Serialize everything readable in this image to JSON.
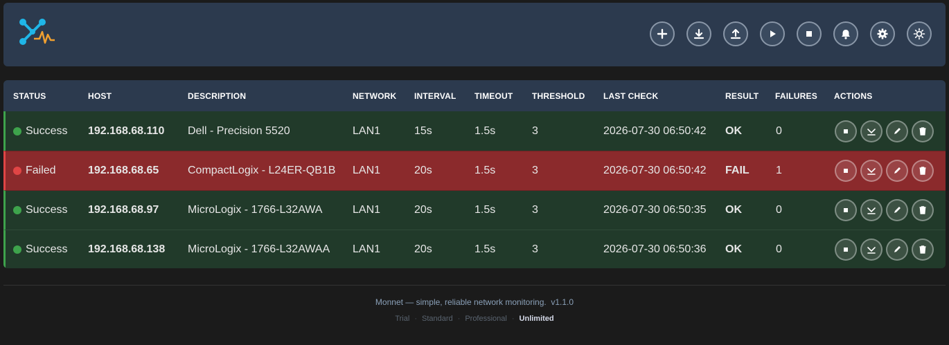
{
  "app": {
    "logo": "monnet-logo"
  },
  "toolbar": {
    "buttons": [
      {
        "name": "add",
        "icon": "plus-icon"
      },
      {
        "name": "download",
        "icon": "download-icon"
      },
      {
        "name": "upload",
        "icon": "upload-icon"
      },
      {
        "name": "start",
        "icon": "play-icon"
      },
      {
        "name": "stop",
        "icon": "stop-icon"
      },
      {
        "name": "notifications",
        "icon": "bell-icon"
      },
      {
        "name": "settings",
        "icon": "gear-icon"
      },
      {
        "name": "theme",
        "icon": "sun-icon"
      }
    ]
  },
  "table": {
    "headers": {
      "status": "STATUS",
      "host": "HOST",
      "description": "DESCRIPTION",
      "network": "NETWORK",
      "interval": "INTERVAL",
      "timeout": "TIMEOUT",
      "threshold": "THRESHOLD",
      "last_check": "LAST CHECK",
      "result": "RESULT",
      "failures": "FAILURES",
      "actions": "ACTIONS"
    },
    "rows": [
      {
        "status": "Success",
        "host": "192.168.68.110",
        "description": "Dell - Precision 5520",
        "network": "LAN1",
        "interval": "15s",
        "timeout": "1.5s",
        "threshold": "3",
        "last_check": "2026-07-30 06:50:42",
        "result": "OK",
        "failures": "0"
      },
      {
        "status": "Failed",
        "host": "192.168.68.65",
        "description": "CompactLogix - L24ER-QB1B",
        "network": "LAN1",
        "interval": "20s",
        "timeout": "1.5s",
        "threshold": "3",
        "last_check": "2026-07-30 06:50:42",
        "result": "FAIL",
        "failures": "1"
      },
      {
        "status": "Success",
        "host": "192.168.68.97",
        "description": "MicroLogix - 1766-L32AWA",
        "network": "LAN1",
        "interval": "20s",
        "timeout": "1.5s",
        "threshold": "3",
        "last_check": "2026-07-30 06:50:35",
        "result": "OK",
        "failures": "0"
      },
      {
        "status": "Success",
        "host": "192.168.68.138",
        "description": "MicroLogix - 1766-L32AWAA",
        "network": "LAN1",
        "interval": "20s",
        "timeout": "1.5s",
        "threshold": "3",
        "last_check": "2026-07-30 06:50:36",
        "result": "OK",
        "failures": "0"
      }
    ],
    "row_actions": [
      "stop-icon",
      "chart-icon",
      "pencil-icon",
      "trash-icon"
    ]
  },
  "footer": {
    "tagline": "Monnet — simple, reliable network monitoring.",
    "version": "v1.1.0",
    "plans": [
      "Trial",
      "Standard",
      "Professional",
      "Unlimited"
    ],
    "active_plan": "Unlimited"
  },
  "colors": {
    "success": "#3ea34c",
    "failed": "#e04545",
    "header_bg": "#2c3a4e",
    "fail_row": "#8b2a2c",
    "ok_row": "#213a2a"
  }
}
